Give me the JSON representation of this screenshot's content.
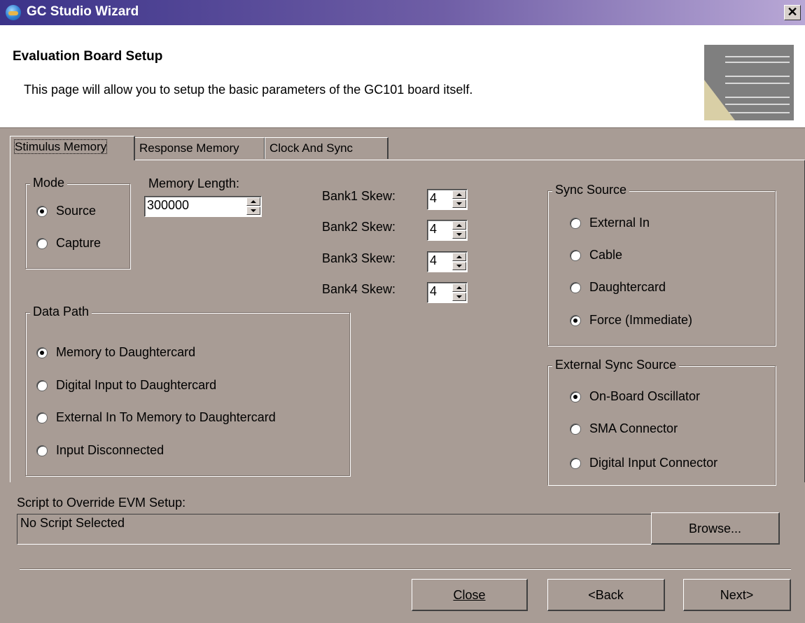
{
  "window": {
    "title": "GC Studio Wizard",
    "close_glyph": "✕"
  },
  "header": {
    "title": "Evaluation Board Setup",
    "description": "This page will allow you to setup the basic parameters of the GC101 board itself."
  },
  "tabs": [
    {
      "label": "Stimulus Memory",
      "active": true
    },
    {
      "label": "Response Memory",
      "active": false
    },
    {
      "label": "Clock And Sync",
      "active": false
    }
  ],
  "mode": {
    "legend": "Mode",
    "options": [
      {
        "label": "Source",
        "selected": true
      },
      {
        "label": "Capture",
        "selected": false
      }
    ]
  },
  "memory_length": {
    "label": "Memory Length:",
    "value": "300000"
  },
  "skews": [
    {
      "label": "Bank1 Skew:",
      "value": "4"
    },
    {
      "label": "Bank2 Skew:",
      "value": "4"
    },
    {
      "label": "Bank3 Skew:",
      "value": "4"
    },
    {
      "label": "Bank4 Skew:",
      "value": "4"
    }
  ],
  "data_path": {
    "legend": "Data Path",
    "options": [
      {
        "label": "Memory to Daughtercard",
        "selected": true
      },
      {
        "label": "Digital Input to Daughtercard",
        "selected": false
      },
      {
        "label": "External In To Memory to Daughtercard",
        "selected": false
      },
      {
        "label": "Input Disconnected",
        "selected": false
      }
    ]
  },
  "sync_source": {
    "legend": "Sync Source",
    "options": [
      {
        "label": "External In",
        "selected": false
      },
      {
        "label": "Cable",
        "selected": false
      },
      {
        "label": "Daughtercard",
        "selected": false
      },
      {
        "label": "Force (Immediate)",
        "selected": true
      }
    ]
  },
  "external_sync_source": {
    "legend": "External Sync Source",
    "options": [
      {
        "label": "On-Board Oscillator",
        "selected": true
      },
      {
        "label": "SMA Connector",
        "selected": false
      },
      {
        "label": "Digital Input Connector",
        "selected": false
      }
    ]
  },
  "script": {
    "label": "Script to Override EVM Setup:",
    "value": "No Script Selected",
    "browse_label": "Browse..."
  },
  "footer": {
    "close_label": "Close",
    "back_label": "<Back",
    "next_label": "Next>"
  }
}
